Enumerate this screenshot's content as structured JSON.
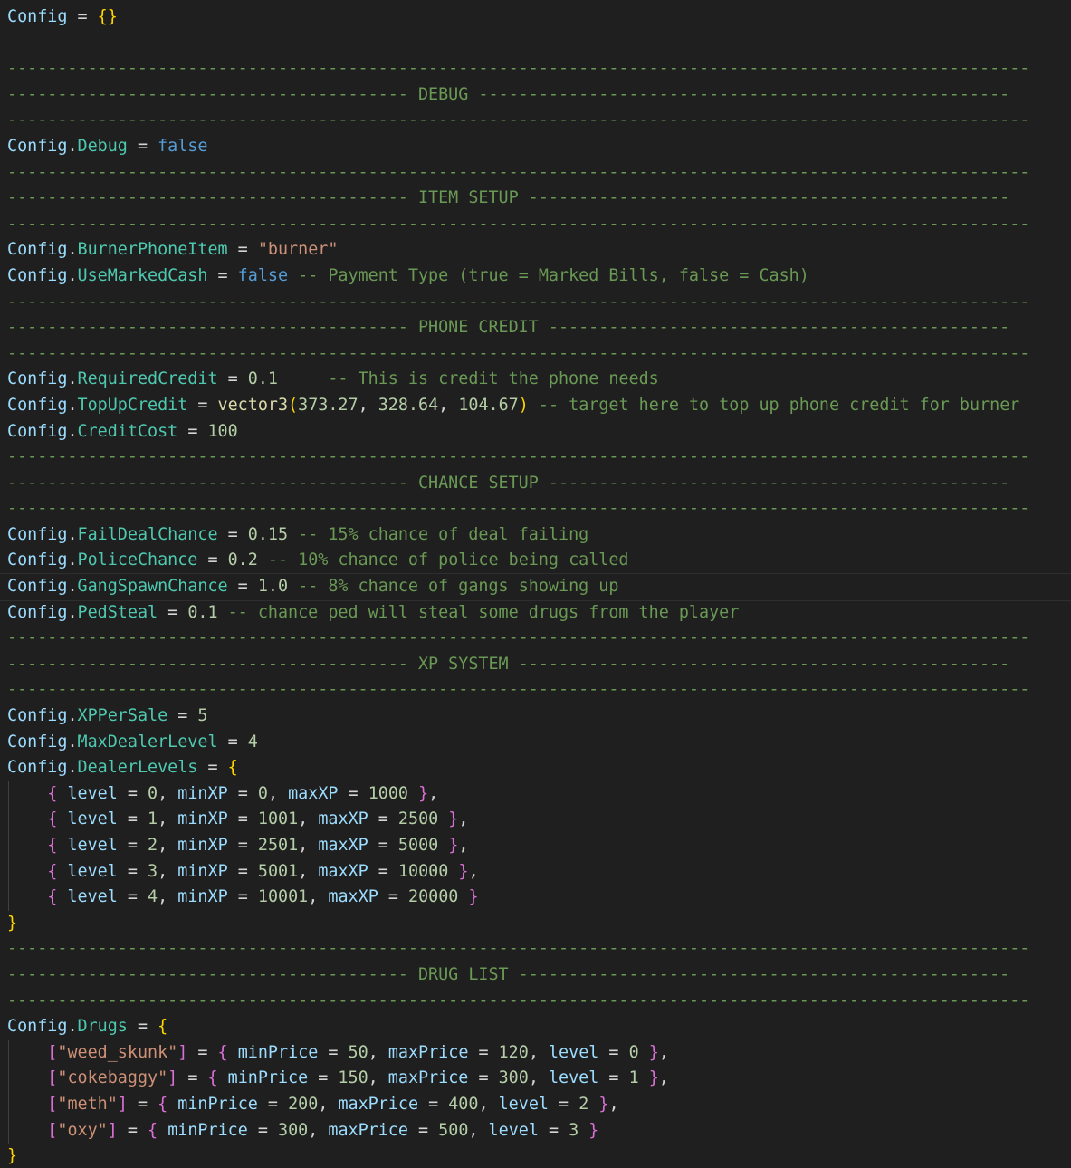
{
  "editor": {
    "language": "lua",
    "colors": {
      "background": "#1f1f1f",
      "comment": "#6a9955",
      "variable": "#9cdcfe",
      "field": "#4ec9b0",
      "keyword": "#569cd6",
      "number": "#b5cea8",
      "string": "#ce9178",
      "function": "#dcdcaa",
      "bracket_1": "#ffd700",
      "bracket_2": "#da70d6"
    },
    "lines": [
      [
        [
          "v",
          "Config"
        ],
        [
          "w",
          " = "
        ],
        [
          "b1",
          "{}"
        ]
      ],
      [],
      [
        [
          "c",
          "------------------------------------------------------------------------------------------------------"
        ]
      ],
      [
        [
          "c",
          "---------------------------------------- DEBUG -----------------------------------------------------"
        ]
      ],
      [
        [
          "c",
          "------------------------------------------------------------------------------------------------------"
        ]
      ],
      [
        [
          "v",
          "Config"
        ],
        [
          "w",
          "."
        ],
        [
          "f",
          "Debug"
        ],
        [
          "w",
          " = "
        ],
        [
          "k",
          "false"
        ]
      ],
      [
        [
          "c",
          "------------------------------------------------------------------------------------------------------"
        ]
      ],
      [
        [
          "c",
          "---------------------------------------- ITEM SETUP ------------------------------------------------"
        ]
      ],
      [
        [
          "c",
          "------------------------------------------------------------------------------------------------------"
        ]
      ],
      [
        [
          "v",
          "Config"
        ],
        [
          "w",
          "."
        ],
        [
          "f",
          "BurnerPhoneItem"
        ],
        [
          "w",
          " = "
        ],
        [
          "s",
          "\"burner\""
        ]
      ],
      [
        [
          "v",
          "Config"
        ],
        [
          "w",
          "."
        ],
        [
          "f",
          "UseMarkedCash"
        ],
        [
          "w",
          " = "
        ],
        [
          "k",
          "false"
        ],
        [
          "c",
          " -- Payment Type (true = Marked Bills, false = Cash)"
        ]
      ],
      [
        [
          "c",
          "------------------------------------------------------------------------------------------------------"
        ]
      ],
      [
        [
          "c",
          "---------------------------------------- PHONE CREDIT ----------------------------------------------"
        ]
      ],
      [
        [
          "c",
          "------------------------------------------------------------------------------------------------------"
        ]
      ],
      [
        [
          "v",
          "Config"
        ],
        [
          "w",
          "."
        ],
        [
          "f",
          "RequiredCredit"
        ],
        [
          "w",
          " = "
        ],
        [
          "n",
          "0.1"
        ],
        [
          "c",
          "     -- This is credit the phone needs"
        ]
      ],
      [
        [
          "v",
          "Config"
        ],
        [
          "w",
          "."
        ],
        [
          "f",
          "TopUpCredit"
        ],
        [
          "w",
          " = "
        ],
        [
          "fn",
          "vector3"
        ],
        [
          "b1",
          "("
        ],
        [
          "n",
          "373.27"
        ],
        [
          "w",
          ", "
        ],
        [
          "n",
          "328.64"
        ],
        [
          "w",
          ", "
        ],
        [
          "n",
          "104.67"
        ],
        [
          "b1",
          ")"
        ],
        [
          "c",
          " -- target here to top up phone credit for burner"
        ]
      ],
      [
        [
          "v",
          "Config"
        ],
        [
          "w",
          "."
        ],
        [
          "f",
          "CreditCost"
        ],
        [
          "w",
          " = "
        ],
        [
          "n",
          "100"
        ]
      ],
      [
        [
          "c",
          "------------------------------------------------------------------------------------------------------"
        ]
      ],
      [
        [
          "c",
          "---------------------------------------- CHANCE SETUP ----------------------------------------------"
        ]
      ],
      [
        [
          "c",
          "------------------------------------------------------------------------------------------------------"
        ]
      ],
      [
        [
          "v",
          "Config"
        ],
        [
          "w",
          "."
        ],
        [
          "f",
          "FailDealChance"
        ],
        [
          "w",
          " = "
        ],
        [
          "n",
          "0.15"
        ],
        [
          "c",
          " -- 15% chance of deal failing"
        ]
      ],
      [
        [
          "v",
          "Config"
        ],
        [
          "w",
          "."
        ],
        [
          "f",
          "PoliceChance"
        ],
        [
          "w",
          " = "
        ],
        [
          "n",
          "0.2"
        ],
        [
          "c",
          " -- 10% chance of police being called"
        ]
      ],
      [
        [
          "v",
          "Config"
        ],
        [
          "w",
          "."
        ],
        [
          "f",
          "GangSpawnChance"
        ],
        [
          "w",
          " = "
        ],
        [
          "n",
          "1.0"
        ],
        [
          "c",
          " -- 8% chance of gangs showing up"
        ]
      ],
      [
        [
          "v",
          "Config"
        ],
        [
          "w",
          "."
        ],
        [
          "f",
          "PedSteal"
        ],
        [
          "w",
          " = "
        ],
        [
          "n",
          "0.1"
        ],
        [
          "c",
          " -- chance ped will steal some drugs from the player"
        ]
      ],
      [
        [
          "c",
          "------------------------------------------------------------------------------------------------------"
        ]
      ],
      [
        [
          "c",
          "---------------------------------------- XP SYSTEM -------------------------------------------------"
        ]
      ],
      [
        [
          "c",
          "------------------------------------------------------------------------------------------------------"
        ]
      ],
      [
        [
          "v",
          "Config"
        ],
        [
          "w",
          "."
        ],
        [
          "f",
          "XPPerSale"
        ],
        [
          "w",
          " = "
        ],
        [
          "n",
          "5"
        ]
      ],
      [
        [
          "v",
          "Config"
        ],
        [
          "w",
          "."
        ],
        [
          "f",
          "MaxDealerLevel"
        ],
        [
          "w",
          " = "
        ],
        [
          "n",
          "4"
        ]
      ],
      [
        [
          "v",
          "Config"
        ],
        [
          "w",
          "."
        ],
        [
          "f",
          "DealerLevels"
        ],
        [
          "w",
          " = "
        ],
        [
          "b1",
          "{"
        ]
      ],
      [
        [
          "w",
          "    "
        ],
        [
          "b2",
          "{"
        ],
        [
          "w",
          " "
        ],
        [
          "nm",
          "level"
        ],
        [
          "w",
          " = "
        ],
        [
          "n",
          "0"
        ],
        [
          "w",
          ", "
        ],
        [
          "nm",
          "minXP"
        ],
        [
          "w",
          " = "
        ],
        [
          "n",
          "0"
        ],
        [
          "w",
          ", "
        ],
        [
          "nm",
          "maxXP"
        ],
        [
          "w",
          " = "
        ],
        [
          "n",
          "1000"
        ],
        [
          "w",
          " "
        ],
        [
          "b2",
          "}"
        ],
        [
          "w",
          ","
        ]
      ],
      [
        [
          "w",
          "    "
        ],
        [
          "b2",
          "{"
        ],
        [
          "w",
          " "
        ],
        [
          "nm",
          "level"
        ],
        [
          "w",
          " = "
        ],
        [
          "n",
          "1"
        ],
        [
          "w",
          ", "
        ],
        [
          "nm",
          "minXP"
        ],
        [
          "w",
          " = "
        ],
        [
          "n",
          "1001"
        ],
        [
          "w",
          ", "
        ],
        [
          "nm",
          "maxXP"
        ],
        [
          "w",
          " = "
        ],
        [
          "n",
          "2500"
        ],
        [
          "w",
          " "
        ],
        [
          "b2",
          "}"
        ],
        [
          "w",
          ","
        ]
      ],
      [
        [
          "w",
          "    "
        ],
        [
          "b2",
          "{"
        ],
        [
          "w",
          " "
        ],
        [
          "nm",
          "level"
        ],
        [
          "w",
          " = "
        ],
        [
          "n",
          "2"
        ],
        [
          "w",
          ", "
        ],
        [
          "nm",
          "minXP"
        ],
        [
          "w",
          " = "
        ],
        [
          "n",
          "2501"
        ],
        [
          "w",
          ", "
        ],
        [
          "nm",
          "maxXP"
        ],
        [
          "w",
          " = "
        ],
        [
          "n",
          "5000"
        ],
        [
          "w",
          " "
        ],
        [
          "b2",
          "}"
        ],
        [
          "w",
          ","
        ]
      ],
      [
        [
          "w",
          "    "
        ],
        [
          "b2",
          "{"
        ],
        [
          "w",
          " "
        ],
        [
          "nm",
          "level"
        ],
        [
          "w",
          " = "
        ],
        [
          "n",
          "3"
        ],
        [
          "w",
          ", "
        ],
        [
          "nm",
          "minXP"
        ],
        [
          "w",
          " = "
        ],
        [
          "n",
          "5001"
        ],
        [
          "w",
          ", "
        ],
        [
          "nm",
          "maxXP"
        ],
        [
          "w",
          " = "
        ],
        [
          "n",
          "10000"
        ],
        [
          "w",
          " "
        ],
        [
          "b2",
          "}"
        ],
        [
          "w",
          ","
        ]
      ],
      [
        [
          "w",
          "    "
        ],
        [
          "b2",
          "{"
        ],
        [
          "w",
          " "
        ],
        [
          "nm",
          "level"
        ],
        [
          "w",
          " = "
        ],
        [
          "n",
          "4"
        ],
        [
          "w",
          ", "
        ],
        [
          "nm",
          "minXP"
        ],
        [
          "w",
          " = "
        ],
        [
          "n",
          "10001"
        ],
        [
          "w",
          ", "
        ],
        [
          "nm",
          "maxXP"
        ],
        [
          "w",
          " = "
        ],
        [
          "n",
          "20000"
        ],
        [
          "w",
          " "
        ],
        [
          "b2",
          "}"
        ]
      ],
      [
        [
          "b1",
          "}"
        ]
      ],
      [
        [
          "c",
          "------------------------------------------------------------------------------------------------------"
        ]
      ],
      [
        [
          "c",
          "---------------------------------------- DRUG LIST -------------------------------------------------"
        ]
      ],
      [
        [
          "c",
          "------------------------------------------------------------------------------------------------------"
        ]
      ],
      [
        [
          "v",
          "Config"
        ],
        [
          "w",
          "."
        ],
        [
          "f",
          "Drugs"
        ],
        [
          "w",
          " = "
        ],
        [
          "b1",
          "{"
        ]
      ],
      [
        [
          "w",
          "    "
        ],
        [
          "b2",
          "["
        ],
        [
          "s",
          "\"weed_skunk\""
        ],
        [
          "b2",
          "]"
        ],
        [
          "w",
          " = "
        ],
        [
          "b2",
          "{"
        ],
        [
          "w",
          " "
        ],
        [
          "nm",
          "minPrice"
        ],
        [
          "w",
          " = "
        ],
        [
          "n",
          "50"
        ],
        [
          "w",
          ", "
        ],
        [
          "nm",
          "maxPrice"
        ],
        [
          "w",
          " = "
        ],
        [
          "n",
          "120"
        ],
        [
          "w",
          ", "
        ],
        [
          "nm",
          "level"
        ],
        [
          "w",
          " = "
        ],
        [
          "n",
          "0"
        ],
        [
          "w",
          " "
        ],
        [
          "b2",
          "}"
        ],
        [
          "w",
          ","
        ]
      ],
      [
        [
          "w",
          "    "
        ],
        [
          "b2",
          "["
        ],
        [
          "s",
          "\"cokebaggy\""
        ],
        [
          "b2",
          "]"
        ],
        [
          "w",
          " = "
        ],
        [
          "b2",
          "{"
        ],
        [
          "w",
          " "
        ],
        [
          "nm",
          "minPrice"
        ],
        [
          "w",
          " = "
        ],
        [
          "n",
          "150"
        ],
        [
          "w",
          ", "
        ],
        [
          "nm",
          "maxPrice"
        ],
        [
          "w",
          " = "
        ],
        [
          "n",
          "300"
        ],
        [
          "w",
          ", "
        ],
        [
          "nm",
          "level"
        ],
        [
          "w",
          " = "
        ],
        [
          "n",
          "1"
        ],
        [
          "w",
          " "
        ],
        [
          "b2",
          "}"
        ],
        [
          "w",
          ","
        ]
      ],
      [
        [
          "w",
          "    "
        ],
        [
          "b2",
          "["
        ],
        [
          "s",
          "\"meth\""
        ],
        [
          "b2",
          "]"
        ],
        [
          "w",
          " = "
        ],
        [
          "b2",
          "{"
        ],
        [
          "w",
          " "
        ],
        [
          "nm",
          "minPrice"
        ],
        [
          "w",
          " = "
        ],
        [
          "n",
          "200"
        ],
        [
          "w",
          ", "
        ],
        [
          "nm",
          "maxPrice"
        ],
        [
          "w",
          " = "
        ],
        [
          "n",
          "400"
        ],
        [
          "w",
          ", "
        ],
        [
          "nm",
          "level"
        ],
        [
          "w",
          " = "
        ],
        [
          "n",
          "2"
        ],
        [
          "w",
          " "
        ],
        [
          "b2",
          "}"
        ],
        [
          "w",
          ","
        ]
      ],
      [
        [
          "w",
          "    "
        ],
        [
          "b2",
          "["
        ],
        [
          "s",
          "\"oxy\""
        ],
        [
          "b2",
          "]"
        ],
        [
          "w",
          " = "
        ],
        [
          "b2",
          "{"
        ],
        [
          "w",
          " "
        ],
        [
          "nm",
          "minPrice"
        ],
        [
          "w",
          " = "
        ],
        [
          "n",
          "300"
        ],
        [
          "w",
          ", "
        ],
        [
          "nm",
          "maxPrice"
        ],
        [
          "w",
          " = "
        ],
        [
          "n",
          "500"
        ],
        [
          "w",
          ", "
        ],
        [
          "nm",
          "level"
        ],
        [
          "w",
          " = "
        ],
        [
          "n",
          "3"
        ],
        [
          "w",
          " "
        ],
        [
          "b2",
          "}"
        ]
      ],
      [
        [
          "b1",
          "}"
        ]
      ]
    ],
    "current_line": 22,
    "indented_lines": [
      30,
      31,
      32,
      33,
      34,
      40,
      41,
      42,
      43
    ]
  }
}
